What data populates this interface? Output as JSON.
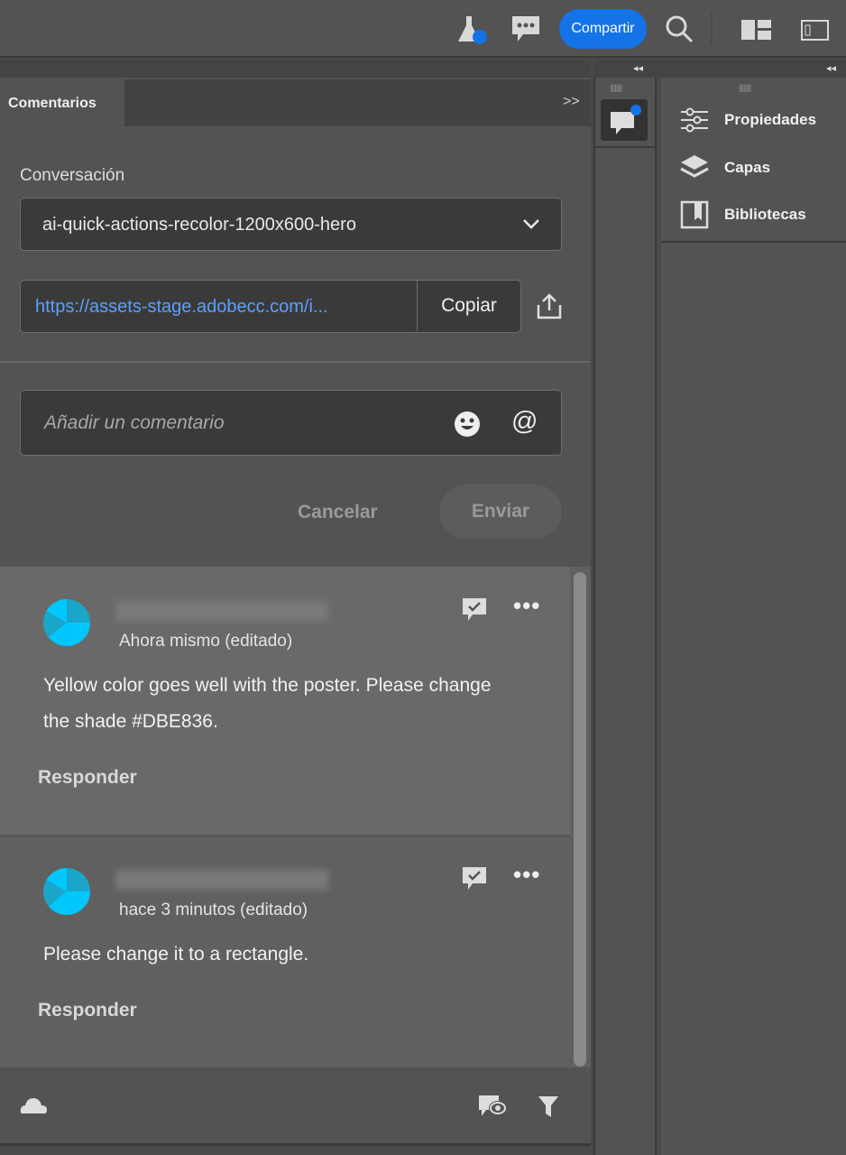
{
  "topbar": {
    "share_label": "Compartir",
    "icons": [
      "flask-icon",
      "chat-icon",
      "search-icon",
      "layout-icon",
      "panel-icon"
    ],
    "accent": "#1473e6"
  },
  "left_panel": {
    "tab": "Comentarios",
    "conversation_label": "Conversación",
    "conversation_value": "ai-quick-actions-recolor-1200x600-hero",
    "link_value": "https://assets-stage.adobecc.com/i...",
    "copy_label": "Copiar",
    "comment_placeholder": "Añadir un comentario",
    "cancel_label": "Cancelar",
    "send_label": "Enviar",
    "comments": [
      {
        "time": "Ahora mismo (editado)",
        "text": "Yellow color goes well with the poster. Please change the shade #DBE836.",
        "reply": "Responder"
      },
      {
        "time": "hace 3 minutos (editado)",
        "text": "Please change it to a rectangle.",
        "reply": "Responder"
      }
    ]
  },
  "right_panel": {
    "items": [
      {
        "label": "Propiedades",
        "icon": "sliders-icon"
      },
      {
        "label": "Capas",
        "icon": "layers-icon"
      },
      {
        "label": "Bibliotecas",
        "icon": "libraries-icon"
      }
    ]
  }
}
